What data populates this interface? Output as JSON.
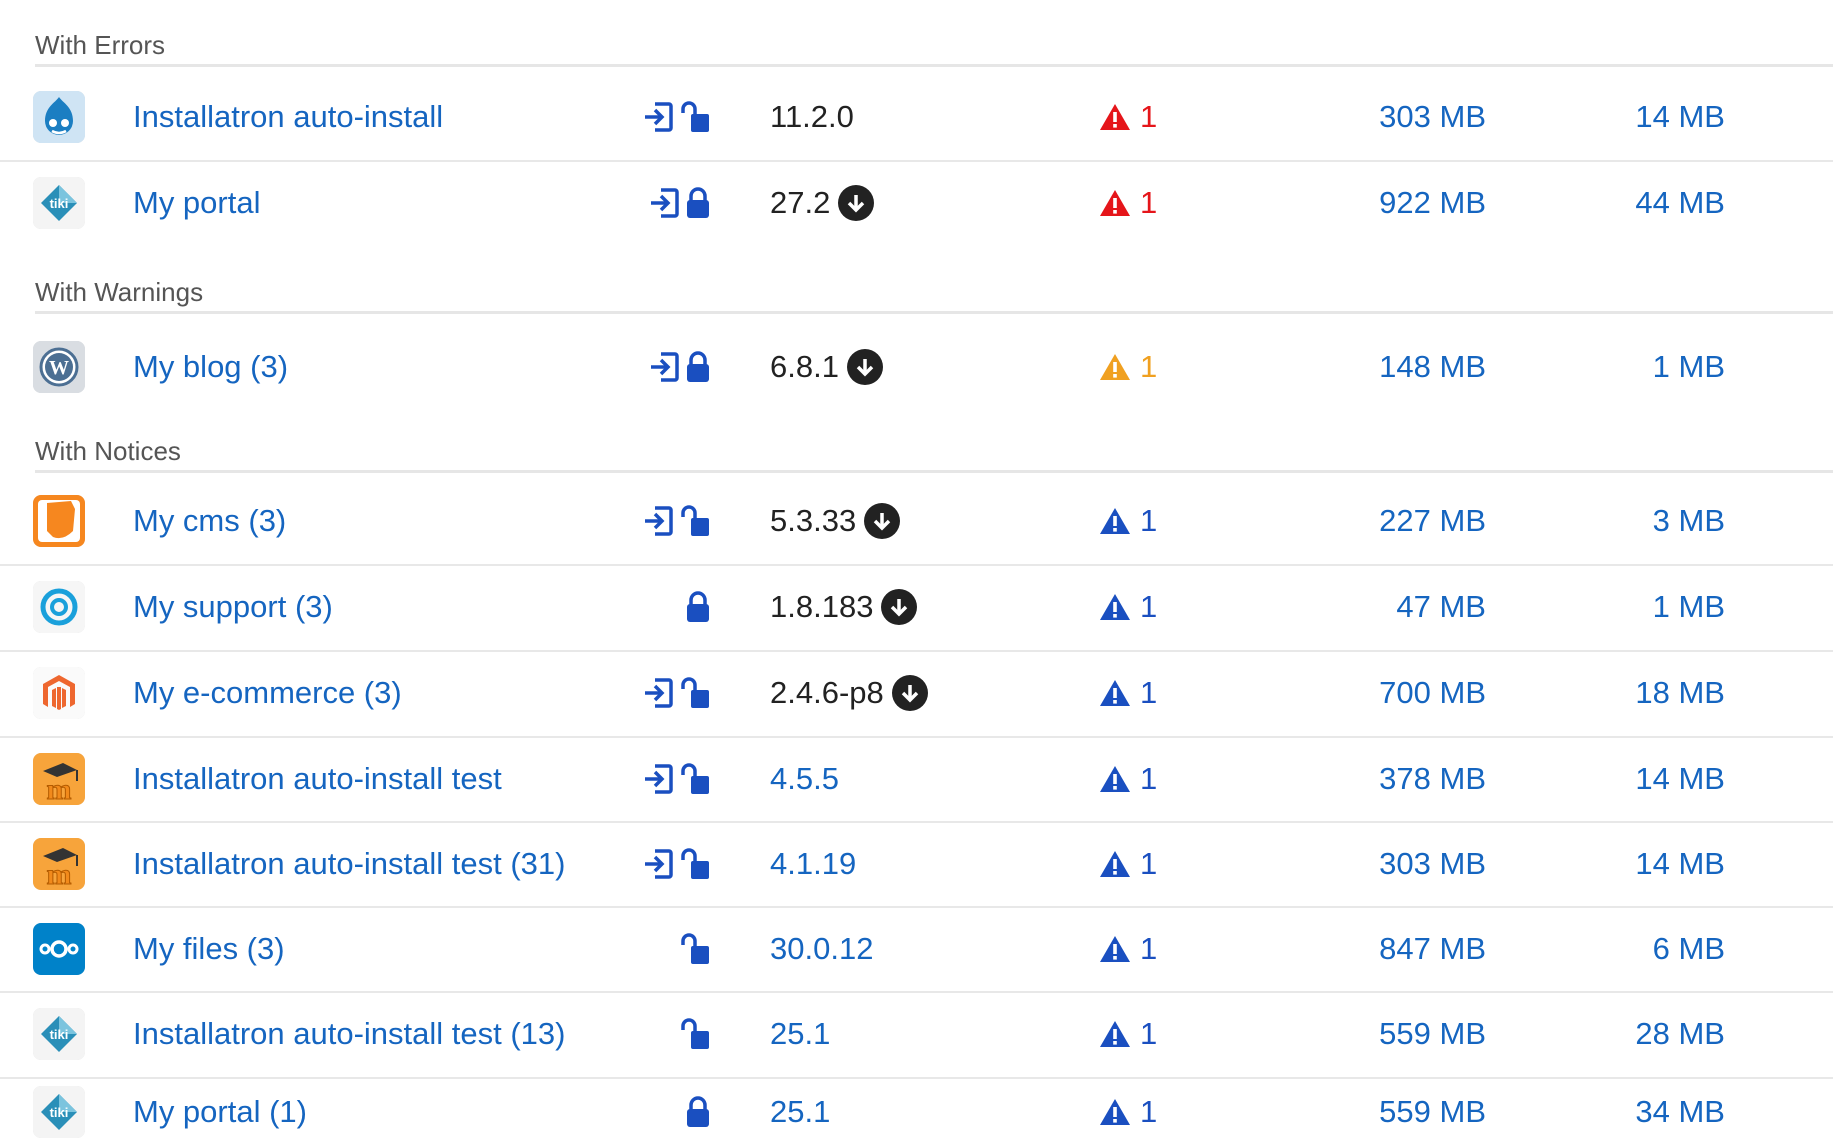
{
  "sections": [
    {
      "title": "With Errors",
      "rows": [
        {
          "app": "drupal-icon",
          "name": "Installatron auto-install",
          "actions": [
            "login",
            "unlock"
          ],
          "version": "11.2.0",
          "version_link": false,
          "update": false,
          "issue_level": "error",
          "issue_count": "1",
          "disk": "303 MB",
          "db": "14 MB"
        },
        {
          "app": "tiki-icon",
          "name": "My portal",
          "actions": [
            "login",
            "lock"
          ],
          "version": "27.2",
          "version_link": false,
          "update": true,
          "issue_level": "error",
          "issue_count": "1",
          "disk": "922 MB",
          "db": "44 MB"
        }
      ]
    },
    {
      "title": "With Warnings",
      "rows": [
        {
          "app": "wordpress-icon",
          "name": "My blog (3)",
          "actions": [
            "login",
            "lock"
          ],
          "version": "6.8.1",
          "version_link": false,
          "update": true,
          "issue_level": "warning",
          "issue_count": "1",
          "disk": "148 MB",
          "db": "1 MB"
        }
      ]
    },
    {
      "title": "With Notices",
      "rows": [
        {
          "app": "contao-icon",
          "name": "My cms (3)",
          "actions": [
            "login",
            "unlock"
          ],
          "version": "5.3.33",
          "version_link": false,
          "update": true,
          "issue_level": "notice",
          "issue_count": "1",
          "disk": "227 MB",
          "db": "3 MB"
        },
        {
          "app": "support-icon",
          "name": "My support (3)",
          "actions": [
            "lock"
          ],
          "version": "1.8.183",
          "version_link": false,
          "update": true,
          "issue_level": "notice",
          "issue_count": "1",
          "disk": "47 MB",
          "db": "1 MB"
        },
        {
          "app": "magento-icon",
          "name": "My e-commerce (3)",
          "actions": [
            "login",
            "unlock"
          ],
          "version": "2.4.6-p8",
          "version_link": false,
          "update": true,
          "issue_level": "notice",
          "issue_count": "1",
          "disk": "700 MB",
          "db": "18 MB"
        },
        {
          "app": "moodle-icon",
          "name": "Installatron auto-install test",
          "actions": [
            "login",
            "unlock"
          ],
          "version": "4.5.5",
          "version_link": true,
          "update": false,
          "issue_level": "notice",
          "issue_count": "1",
          "disk": "378 MB",
          "db": "14 MB"
        },
        {
          "app": "moodle-icon",
          "name": "Installatron auto-install test (31)",
          "actions": [
            "login",
            "unlock"
          ],
          "version": "4.1.19",
          "version_link": true,
          "update": false,
          "issue_level": "notice",
          "issue_count": "1",
          "disk": "303 MB",
          "db": "14 MB"
        },
        {
          "app": "nextcloud-icon",
          "name": "My files (3)",
          "actions": [
            "unlock"
          ],
          "version": "30.0.12",
          "version_link": true,
          "update": false,
          "issue_level": "notice",
          "issue_count": "1",
          "disk": "847 MB",
          "db": "6 MB"
        },
        {
          "app": "tiki-icon",
          "name": "Installatron auto-install test (13)",
          "actions": [
            "unlock"
          ],
          "version": "25.1",
          "version_link": true,
          "update": false,
          "issue_level": "notice",
          "issue_count": "1",
          "disk": "559 MB",
          "db": "28 MB"
        },
        {
          "app": "tiki-icon",
          "name": "My portal (1)",
          "actions": [
            "lock"
          ],
          "version": "25.1",
          "version_link": true,
          "update": false,
          "issue_level": "notice",
          "issue_count": "1",
          "disk": "559 MB",
          "db": "34 MB"
        }
      ]
    }
  ],
  "colors": {
    "link": "#1565c0",
    "error": "#e5151a",
    "warning": "#f0a020",
    "notice": "#1a4fc0",
    "divider": "#e8e8e8",
    "section_text": "#555555"
  }
}
